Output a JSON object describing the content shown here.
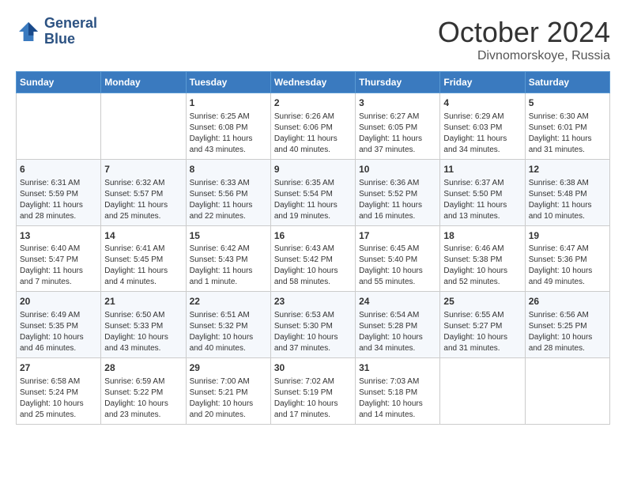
{
  "header": {
    "logo_line1": "General",
    "logo_line2": "Blue",
    "month": "October 2024",
    "location": "Divnomorskoye, Russia"
  },
  "weekdays": [
    "Sunday",
    "Monday",
    "Tuesday",
    "Wednesday",
    "Thursday",
    "Friday",
    "Saturday"
  ],
  "weeks": [
    [
      {
        "day": "",
        "sunrise": "",
        "sunset": "",
        "daylight": ""
      },
      {
        "day": "",
        "sunrise": "",
        "sunset": "",
        "daylight": ""
      },
      {
        "day": "1",
        "sunrise": "Sunrise: 6:25 AM",
        "sunset": "Sunset: 6:08 PM",
        "daylight": "Daylight: 11 hours and 43 minutes."
      },
      {
        "day": "2",
        "sunrise": "Sunrise: 6:26 AM",
        "sunset": "Sunset: 6:06 PM",
        "daylight": "Daylight: 11 hours and 40 minutes."
      },
      {
        "day": "3",
        "sunrise": "Sunrise: 6:27 AM",
        "sunset": "Sunset: 6:05 PM",
        "daylight": "Daylight: 11 hours and 37 minutes."
      },
      {
        "day": "4",
        "sunrise": "Sunrise: 6:29 AM",
        "sunset": "Sunset: 6:03 PM",
        "daylight": "Daylight: 11 hours and 34 minutes."
      },
      {
        "day": "5",
        "sunrise": "Sunrise: 6:30 AM",
        "sunset": "Sunset: 6:01 PM",
        "daylight": "Daylight: 11 hours and 31 minutes."
      }
    ],
    [
      {
        "day": "6",
        "sunrise": "Sunrise: 6:31 AM",
        "sunset": "Sunset: 5:59 PM",
        "daylight": "Daylight: 11 hours and 28 minutes."
      },
      {
        "day": "7",
        "sunrise": "Sunrise: 6:32 AM",
        "sunset": "Sunset: 5:57 PM",
        "daylight": "Daylight: 11 hours and 25 minutes."
      },
      {
        "day": "8",
        "sunrise": "Sunrise: 6:33 AM",
        "sunset": "Sunset: 5:56 PM",
        "daylight": "Daylight: 11 hours and 22 minutes."
      },
      {
        "day": "9",
        "sunrise": "Sunrise: 6:35 AM",
        "sunset": "Sunset: 5:54 PM",
        "daylight": "Daylight: 11 hours and 19 minutes."
      },
      {
        "day": "10",
        "sunrise": "Sunrise: 6:36 AM",
        "sunset": "Sunset: 5:52 PM",
        "daylight": "Daylight: 11 hours and 16 minutes."
      },
      {
        "day": "11",
        "sunrise": "Sunrise: 6:37 AM",
        "sunset": "Sunset: 5:50 PM",
        "daylight": "Daylight: 11 hours and 13 minutes."
      },
      {
        "day": "12",
        "sunrise": "Sunrise: 6:38 AM",
        "sunset": "Sunset: 5:48 PM",
        "daylight": "Daylight: 11 hours and 10 minutes."
      }
    ],
    [
      {
        "day": "13",
        "sunrise": "Sunrise: 6:40 AM",
        "sunset": "Sunset: 5:47 PM",
        "daylight": "Daylight: 11 hours and 7 minutes."
      },
      {
        "day": "14",
        "sunrise": "Sunrise: 6:41 AM",
        "sunset": "Sunset: 5:45 PM",
        "daylight": "Daylight: 11 hours and 4 minutes."
      },
      {
        "day": "15",
        "sunrise": "Sunrise: 6:42 AM",
        "sunset": "Sunset: 5:43 PM",
        "daylight": "Daylight: 11 hours and 1 minute."
      },
      {
        "day": "16",
        "sunrise": "Sunrise: 6:43 AM",
        "sunset": "Sunset: 5:42 PM",
        "daylight": "Daylight: 10 hours and 58 minutes."
      },
      {
        "day": "17",
        "sunrise": "Sunrise: 6:45 AM",
        "sunset": "Sunset: 5:40 PM",
        "daylight": "Daylight: 10 hours and 55 minutes."
      },
      {
        "day": "18",
        "sunrise": "Sunrise: 6:46 AM",
        "sunset": "Sunset: 5:38 PM",
        "daylight": "Daylight: 10 hours and 52 minutes."
      },
      {
        "day": "19",
        "sunrise": "Sunrise: 6:47 AM",
        "sunset": "Sunset: 5:36 PM",
        "daylight": "Daylight: 10 hours and 49 minutes."
      }
    ],
    [
      {
        "day": "20",
        "sunrise": "Sunrise: 6:49 AM",
        "sunset": "Sunset: 5:35 PM",
        "daylight": "Daylight: 10 hours and 46 minutes."
      },
      {
        "day": "21",
        "sunrise": "Sunrise: 6:50 AM",
        "sunset": "Sunset: 5:33 PM",
        "daylight": "Daylight: 10 hours and 43 minutes."
      },
      {
        "day": "22",
        "sunrise": "Sunrise: 6:51 AM",
        "sunset": "Sunset: 5:32 PM",
        "daylight": "Daylight: 10 hours and 40 minutes."
      },
      {
        "day": "23",
        "sunrise": "Sunrise: 6:53 AM",
        "sunset": "Sunset: 5:30 PM",
        "daylight": "Daylight: 10 hours and 37 minutes."
      },
      {
        "day": "24",
        "sunrise": "Sunrise: 6:54 AM",
        "sunset": "Sunset: 5:28 PM",
        "daylight": "Daylight: 10 hours and 34 minutes."
      },
      {
        "day": "25",
        "sunrise": "Sunrise: 6:55 AM",
        "sunset": "Sunset: 5:27 PM",
        "daylight": "Daylight: 10 hours and 31 minutes."
      },
      {
        "day": "26",
        "sunrise": "Sunrise: 6:56 AM",
        "sunset": "Sunset: 5:25 PM",
        "daylight": "Daylight: 10 hours and 28 minutes."
      }
    ],
    [
      {
        "day": "27",
        "sunrise": "Sunrise: 6:58 AM",
        "sunset": "Sunset: 5:24 PM",
        "daylight": "Daylight: 10 hours and 25 minutes."
      },
      {
        "day": "28",
        "sunrise": "Sunrise: 6:59 AM",
        "sunset": "Sunset: 5:22 PM",
        "daylight": "Daylight: 10 hours and 23 minutes."
      },
      {
        "day": "29",
        "sunrise": "Sunrise: 7:00 AM",
        "sunset": "Sunset: 5:21 PM",
        "daylight": "Daylight: 10 hours and 20 minutes."
      },
      {
        "day": "30",
        "sunrise": "Sunrise: 7:02 AM",
        "sunset": "Sunset: 5:19 PM",
        "daylight": "Daylight: 10 hours and 17 minutes."
      },
      {
        "day": "31",
        "sunrise": "Sunrise: 7:03 AM",
        "sunset": "Sunset: 5:18 PM",
        "daylight": "Daylight: 10 hours and 14 minutes."
      },
      {
        "day": "",
        "sunrise": "",
        "sunset": "",
        "daylight": ""
      },
      {
        "day": "",
        "sunrise": "",
        "sunset": "",
        "daylight": ""
      }
    ]
  ]
}
